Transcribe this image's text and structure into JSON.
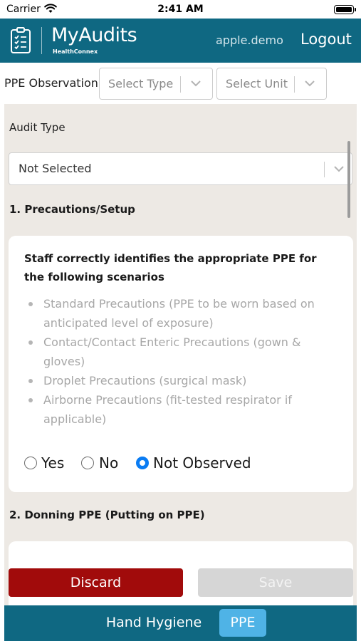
{
  "status_bar": {
    "carrier": "Carrier",
    "time": "2:41 AM"
  },
  "header": {
    "brand": "MyAudits",
    "brand_sub": "HealthConnex",
    "username": "apple.demo",
    "logout_label": "Logout",
    "background": "#0f6882"
  },
  "filters": {
    "label": "PPE Observation",
    "type_placeholder": "Select Type",
    "unit_placeholder": "Select Unit"
  },
  "audit": {
    "type_label": "Audit Type",
    "type_value": "Not Selected",
    "sections": [
      {
        "title": "1. Precautions/Setup",
        "question": "Staff correctly identifies the appropriate PPE for the following scenarios",
        "bullets": [
          "Standard Precautions (PPE to be worn based on anticipated level of exposure)",
          "Contact/Contact Enteric Precautions (gown & gloves)",
          "Droplet Precautions (surgical mask)",
          "Airborne Precautions (fit-tested respirator if applicable)"
        ],
        "options": [
          "Yes",
          "No",
          "Not Observed"
        ],
        "selected": "Not Observed"
      },
      {
        "title": "2. Donning PPE (Putting on PPE)"
      }
    ]
  },
  "actions": {
    "discard_label": "Discard",
    "save_label": "Save",
    "discard_color": "#a10b0b"
  },
  "tabs": [
    {
      "label": "Hand Hygiene",
      "active": false
    },
    {
      "label": "PPE",
      "active": true
    }
  ],
  "icons": [
    "wifi-icon",
    "battery-icon",
    "clipboard-checklist-icon",
    "chevron-down-icon",
    "radio-button-icon"
  ]
}
